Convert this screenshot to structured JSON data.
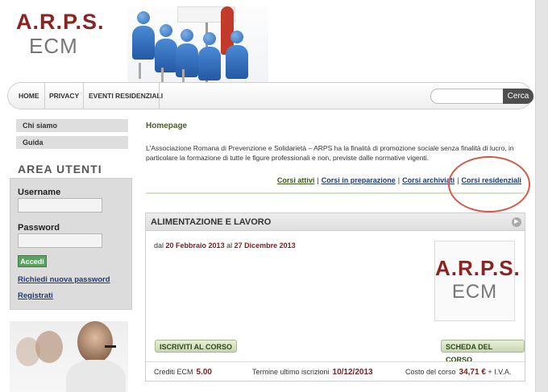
{
  "logo": {
    "line1": "A.R.P.S.",
    "line2": "ECM"
  },
  "nav": {
    "items": [
      "HOME",
      "PRIVACY",
      "EVENTI RESIDENZIALI"
    ],
    "search_button": "Cerca",
    "search_placeholder": ""
  },
  "sidebar": {
    "links": [
      "Chi siamo",
      "Guida"
    ],
    "area_title": "AREA UTENTI",
    "username_label": "Username",
    "password_label": "Password",
    "login_button": "Accedi",
    "forgot_link": "Richiedi nuova password",
    "register_link": "Registrati"
  },
  "main": {
    "title": "Homepage",
    "intro": "L'Associazione Romana di Prevenzione e Solidarietà – ARPS ha la finalità di promozione sociale senza finalità di lucro, in particolare la formazione di tutte le figure professionali e non, previste dalle normative vigenti.",
    "tabs": [
      "Corsi attivi",
      "Corsi in preparazione",
      "Corsi archiviati",
      "Corsi residenziali"
    ],
    "tab_separator": "|"
  },
  "course": {
    "title": "ALIMENTAZIONE E LAVORO",
    "date_prefix": "dal",
    "date_from": "20 Febbraio 2013",
    "date_mid": "al",
    "date_to": "27 Dicembre 2013",
    "logo_line1": "A.R.P.S.",
    "logo_line2": "ECM",
    "enroll_button": "ISCRIVITI AL CORSO",
    "details_button": "SCHEDA DEL CORSO",
    "credits_label": "Crediti ECM",
    "credits_value": "5.00",
    "deadline_label": "Termine ultimo iscrizioni",
    "deadline_value": "10/12/2013",
    "cost_label": "Costo del corso",
    "cost_value": "34,71 €",
    "cost_suffix": "+ I.V.A."
  },
  "colors": {
    "brand_red": "#8b2323",
    "link_blue": "#1f3b7a",
    "accent_green": "#5aa060",
    "annotation_red": "#d35a4a"
  }
}
